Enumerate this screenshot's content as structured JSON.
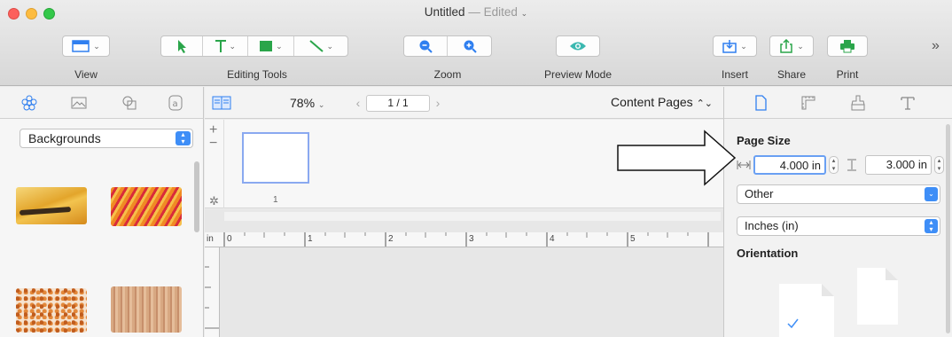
{
  "window": {
    "title": "Untitled",
    "separator": "—",
    "status": "Edited"
  },
  "toolbar": {
    "view_label": "View",
    "editing_tools_label": "Editing Tools",
    "zoom_label": "Zoom",
    "preview_label": "Preview Mode",
    "insert_label": "Insert",
    "share_label": "Share",
    "print_label": "Print",
    "overflow": "»"
  },
  "sidebar": {
    "tabs": [
      "shapes",
      "images",
      "clipboard",
      "text"
    ],
    "category": "Backgrounds",
    "thumbnails": [
      "yellow-texture",
      "orange-red-texture",
      "orange-dots-texture",
      "brown-texture"
    ]
  },
  "center": {
    "zoom_value": "78%",
    "page_indicator": "1 / 1",
    "pages_mode": "Content Pages",
    "page_thumb_number": "1",
    "ruler_unit": "in",
    "ruler_numbers": [
      "0",
      "1",
      "2",
      "3",
      "4",
      "5"
    ]
  },
  "inspector": {
    "page_size_title": "Page Size",
    "width_value": "4.000 in",
    "height_value": "3.000 in",
    "size_preset": "Other",
    "units": "Inches (in)",
    "orientation_title": "Orientation",
    "selected_orientation": "portrait"
  },
  "colors": {
    "accent": "#3e8ef7",
    "close": "#fc605c",
    "minimize": "#fdbc40",
    "maximize": "#34c84a"
  }
}
